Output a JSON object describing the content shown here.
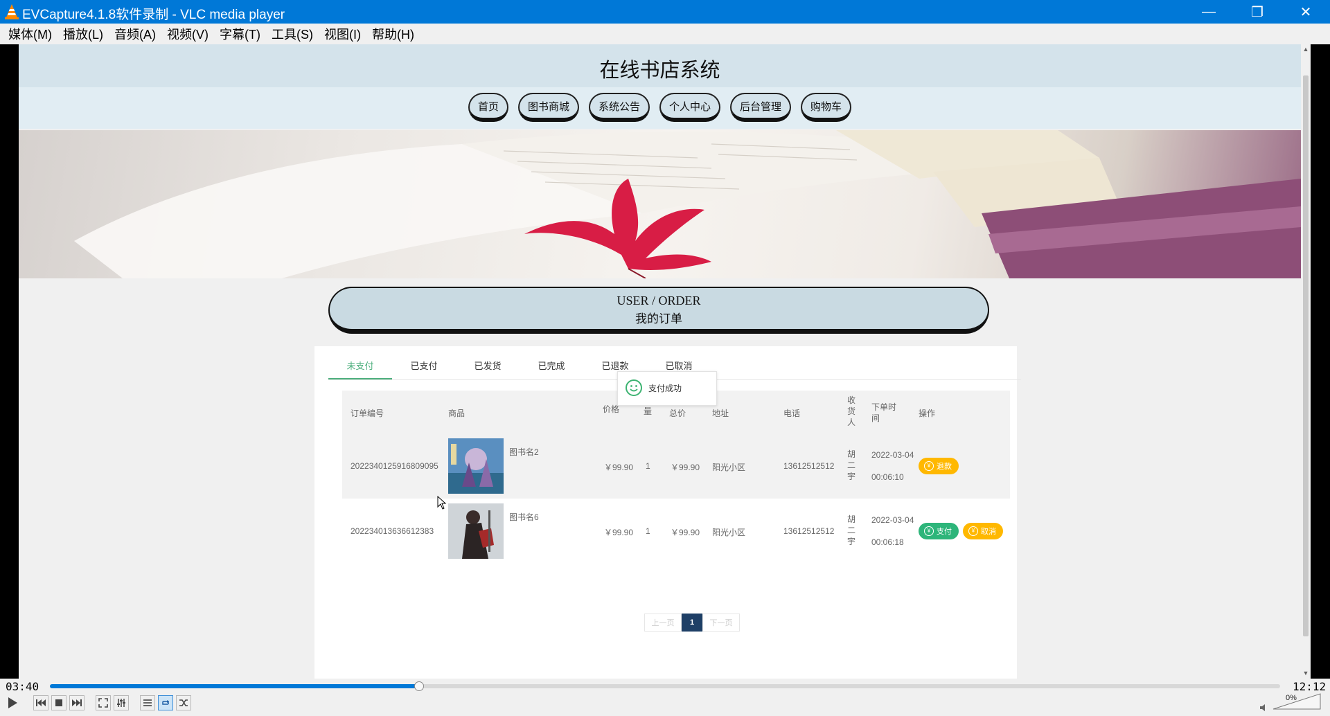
{
  "window": {
    "title": "EVCapture4.1.8软件录制 - VLC media player",
    "controls": {
      "minimize": "—",
      "restore": "❐",
      "close": "✕"
    }
  },
  "menu": [
    "媒体(M)",
    "播放(L)",
    "音频(A)",
    "视频(V)",
    "字幕(T)",
    "工具(S)",
    "视图(I)",
    "帮助(H)"
  ],
  "site": {
    "title": "在线书店系统",
    "nav": [
      "首页",
      "图书商城",
      "系统公告",
      "个人中心",
      "后台管理",
      "购物车"
    ]
  },
  "order_header": {
    "en": "USER / ORDER",
    "cn": "我的订单"
  },
  "tabs": [
    {
      "label": "未支付",
      "active": true
    },
    {
      "label": "已支付",
      "active": false
    },
    {
      "label": "已发货",
      "active": false
    },
    {
      "label": "已完成",
      "active": false
    },
    {
      "label": "已退款",
      "active": false
    },
    {
      "label": "已取消",
      "active": false
    }
  ],
  "toast": {
    "message": "支付成功",
    "icon": "smile-icon"
  },
  "table": {
    "headers": {
      "order_no": "订单编号",
      "product": "商品",
      "price": "价格",
      "qty": "数量",
      "total": "总价",
      "address": "地址",
      "phone": "电话",
      "receiver": "收货人",
      "time": "下单时间",
      "action": "操作"
    },
    "rows": [
      {
        "order_no": "2022340125916809095",
        "book": "图书名2",
        "price": "￥99.90",
        "qty": "1",
        "total": "￥99.90",
        "address": "阳光小区",
        "phone": "13612512512",
        "receiver": "胡二宇",
        "time_date": "2022-03-04",
        "time_clock": "00:06:10",
        "actions": [
          "退款"
        ]
      },
      {
        "order_no": "202234013636612383",
        "book": "图书名6",
        "price": "￥99.90",
        "qty": "1",
        "total": "￥99.90",
        "address": "阳光小区",
        "phone": "13612512512",
        "receiver": "胡二宇",
        "time_date": "2022-03-04",
        "time_clock": "00:06:18",
        "actions": [
          "支付",
          "取消"
        ]
      }
    ]
  },
  "pager": {
    "prev": "上一页",
    "current": "1",
    "next": "下一页"
  },
  "player": {
    "elapsed": "03:40",
    "total": "12:12",
    "progress": 0.3,
    "volume": "0%"
  },
  "colors": {
    "titlebar": "#0078d7",
    "tab_active": "#4caf7d",
    "btn_yellow": "#ffb800",
    "btn_green": "#2db57a",
    "pager_current": "#1e3f66"
  }
}
